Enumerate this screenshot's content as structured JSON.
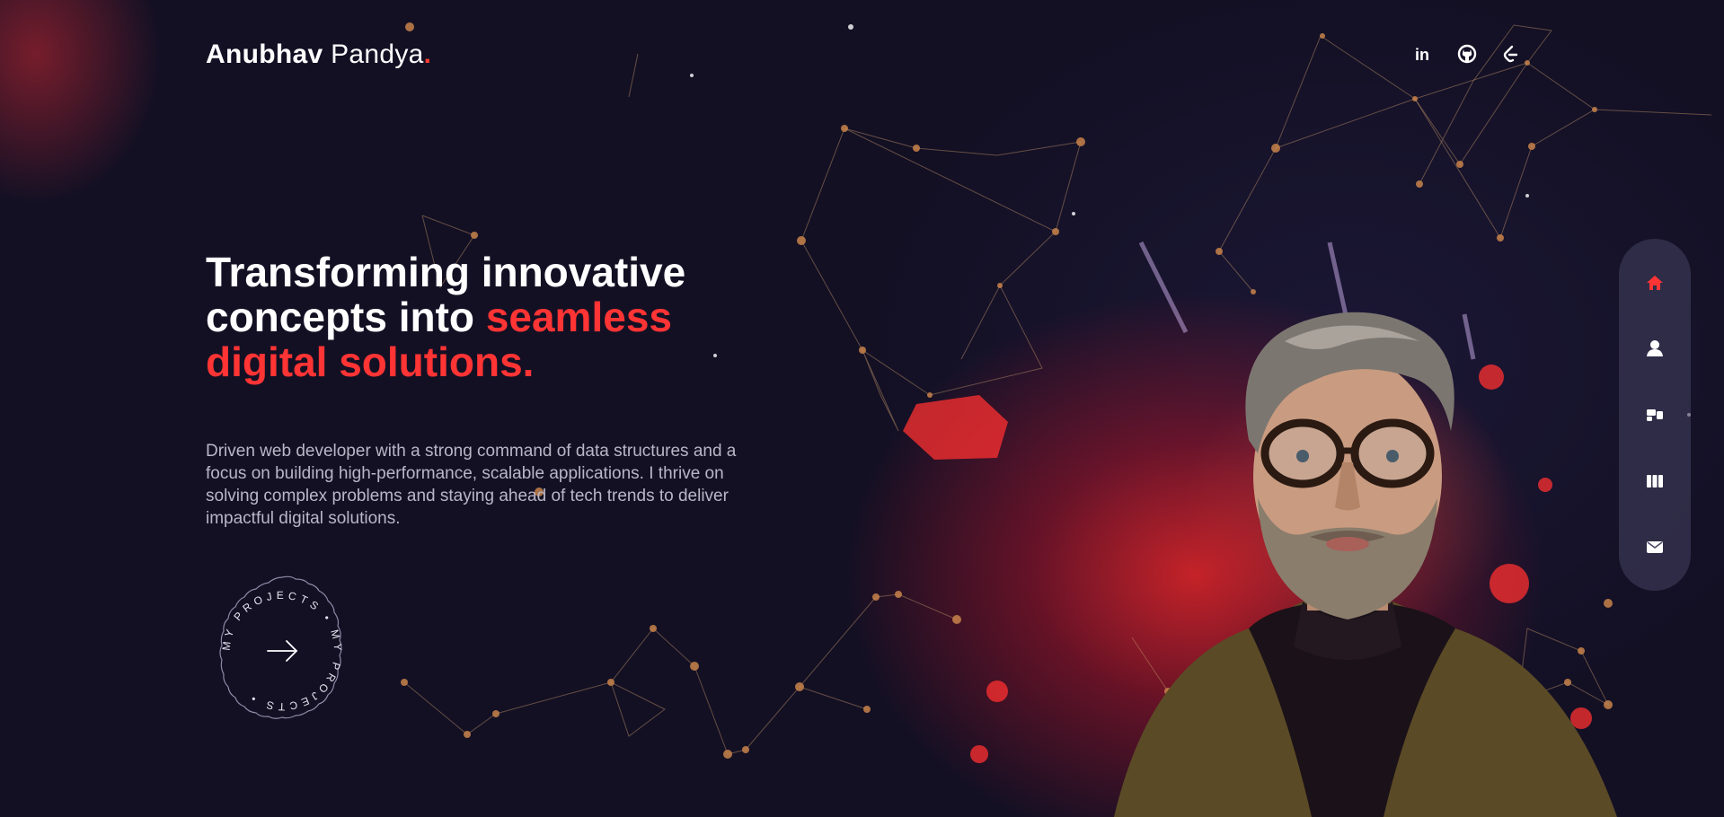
{
  "header": {
    "logo_first": "Anubhav",
    "logo_last": "Pandya",
    "logo_dot": ".",
    "social": [
      {
        "icon": "linkedin-icon"
      },
      {
        "icon": "github-icon"
      },
      {
        "icon": "leetcode-icon"
      }
    ]
  },
  "hero": {
    "headline_plain": "Transforming innovative concepts into ",
    "headline_accent": "seamless digital solutions.",
    "description": "Driven web developer with a strong command of data structures and a focus on building high-performance, scalable applications. I thrive on solving complex problems and staying ahead of tech trends to deliver impactful digital solutions.",
    "projects_badge_text": "MY PROJECTS • MY PROJECTS •"
  },
  "sidenav": {
    "items": [
      {
        "icon": "home-icon",
        "active": true
      },
      {
        "icon": "user-icon",
        "active": false
      },
      {
        "icon": "services-icon",
        "active": false
      },
      {
        "icon": "portfolio-icon",
        "active": false
      },
      {
        "icon": "mail-icon",
        "active": false
      }
    ]
  },
  "colors": {
    "accent": "#ff3434",
    "background": "#131024",
    "text_muted": "#b9b6c7",
    "nav_bg": "#464260"
  }
}
